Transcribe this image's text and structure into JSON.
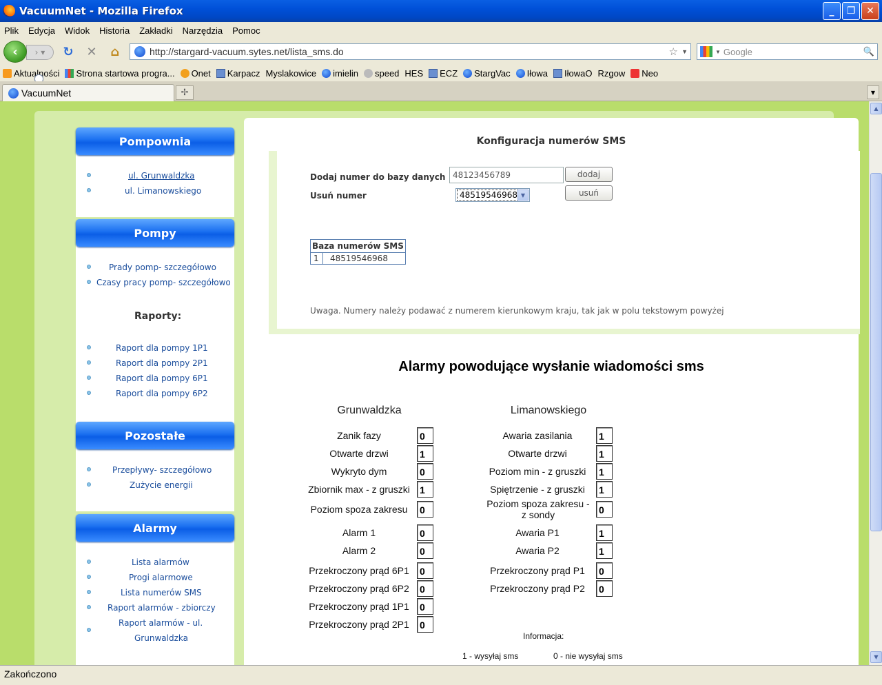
{
  "window": {
    "title": "VacuumNet - Mozilla Firefox"
  },
  "menu": [
    "Plik",
    "Edycja",
    "Widok",
    "Historia",
    "Zakładki",
    "Narzędzia",
    "Pomoc"
  ],
  "url": "http://stargard-vacuum.sytes.net/lista_sms.do",
  "search_placeholder": "Google",
  "bookmarks": [
    {
      "label": "Aktualności",
      "icon": "rss"
    },
    {
      "label": "Strona startowa progra...",
      "icon": "ggl"
    },
    {
      "label": "Onet",
      "icon": "onet"
    },
    {
      "label": "Karpacz",
      "icon": "pic"
    },
    {
      "label": "Myslakowice",
      "icon": "page"
    },
    {
      "label": "imielin",
      "icon": "blue"
    },
    {
      "label": "speed",
      "icon": "speed"
    },
    {
      "label": "HES",
      "icon": "page"
    },
    {
      "label": "ECZ",
      "icon": "pic"
    },
    {
      "label": "StargVac",
      "icon": "blue"
    },
    {
      "label": "Iłowa",
      "icon": "blue"
    },
    {
      "label": "IłowaO",
      "icon": "pic"
    },
    {
      "label": "Rzgow",
      "icon": "page"
    },
    {
      "label": "Neo",
      "icon": "neo"
    }
  ],
  "tab": {
    "label": "VacuumNet"
  },
  "status": "Zakończono",
  "sidebar": {
    "pompownia": {
      "title": "Pompownia",
      "links": [
        "ul. Grunwaldzka",
        "ul. Limanowskiego"
      ]
    },
    "pompy": {
      "title": "Pompy",
      "links": [
        "Prady pomp- szczegółowo",
        "Czasy pracy pomp- szczegółowo"
      ],
      "raporty_label": "Raporty:",
      "raporty": [
        "Raport dla pompy 1P1",
        "Raport dla pompy 2P1",
        "Raport dla pompy 6P1",
        "Raport dla pompy 6P2"
      ]
    },
    "pozostale": {
      "title": "Pozostałe",
      "links": [
        "Przepływy- szczegółowo",
        "Zużycie energii"
      ]
    },
    "alarmy": {
      "title": "Alarmy",
      "links": [
        "Lista alarmów",
        "Progi alarmowe",
        "Lista numerów SMS",
        "Raport alarmów - zbiorczy",
        "Raport alarmów - ul.",
        "Grunwaldzka"
      ]
    }
  },
  "config": {
    "title": "Konfiguracja numerów SMS",
    "add_label": "Dodaj numer do bazy danych",
    "add_value": "48123456789",
    "add_button": "dodaj",
    "remove_label": "Usuń numer",
    "remove_selected": "48519546968",
    "remove_button": "usuń",
    "table_header": "Baza numerów SMS",
    "table_rows": [
      {
        "idx": "1",
        "number": "48519546968"
      }
    ],
    "note": "Uwaga. Numery należy podawać z numerem kierunkowym kraju, tak jak w polu tekstowym powyżej"
  },
  "alarms": {
    "title": "Alarmy powodujące wysłanie wiadomości sms",
    "left_head": "Grunwaldzka",
    "right_head": "Limanowskiego",
    "left": [
      {
        "label": "Zanik fazy",
        "value": "0"
      },
      {
        "label": "Otwarte drzwi",
        "value": "1"
      },
      {
        "label": "Wykryto dym",
        "value": "0"
      },
      {
        "label": "Zbiornik max - z gruszki",
        "value": "1"
      },
      {
        "label": "Poziom spoza zakresu",
        "value": "0"
      },
      {
        "label": "Alarm 1",
        "value": "0"
      },
      {
        "label": "Alarm 2",
        "value": "0"
      },
      {
        "label": "Przekroczony prąd 6P1",
        "value": "0"
      },
      {
        "label": "Przekroczony prąd 6P2",
        "value": "0"
      },
      {
        "label": "Przekroczony prąd 1P1",
        "value": "0"
      },
      {
        "label": "Przekroczony prąd 2P1",
        "value": "0"
      }
    ],
    "right": [
      {
        "label": "Awaria zasilania",
        "value": "1"
      },
      {
        "label": "Otwarte drzwi",
        "value": "1"
      },
      {
        "label": "Poziom min - z gruszki",
        "value": "1"
      },
      {
        "label": "Spiętrzenie - z gruszki",
        "value": "1"
      },
      {
        "label": "Poziom spoza zakresu - z sondy",
        "value": "0"
      },
      {
        "label": "Awaria P1",
        "value": "1"
      },
      {
        "label": "Awaria P2",
        "value": "1"
      },
      {
        "label": "Przekroczony prąd P1",
        "value": "0"
      },
      {
        "label": "Przekroczony prąd P2",
        "value": "0"
      }
    ],
    "info_label": "Informacja:",
    "info_send": "1 - wysyłaj sms",
    "info_nosend": "0 - nie wysyłaj sms"
  }
}
